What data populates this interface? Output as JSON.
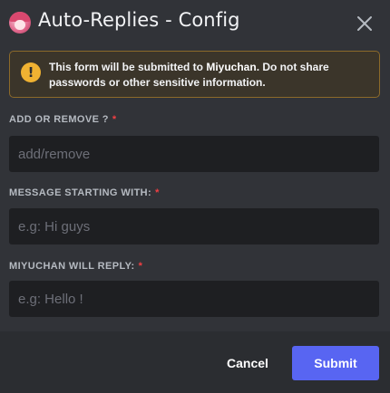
{
  "header": {
    "title": "Auto-Replies - Config",
    "close_icon": "close-icon"
  },
  "notice": {
    "icon": "warning-icon",
    "icon_glyph": "!",
    "text_before": "This form will be submitted to ",
    "bot_name": "Miyuchan",
    "text_after": ". Do not share passwords or other sensitive information."
  },
  "fields": [
    {
      "label": "ADD OR REMOVE ?",
      "required_mark": "*",
      "placeholder": "add/remove",
      "value": ""
    },
    {
      "label": "MESSAGE STARTING WITH:",
      "required_mark": "*",
      "placeholder": "e.g: Hi guys",
      "value": ""
    },
    {
      "label": "MIYUCHAN WILL REPLY:",
      "required_mark": "*",
      "placeholder": "e.g: Hello !",
      "value": ""
    }
  ],
  "footer": {
    "cancel_label": "Cancel",
    "submit_label": "Submit"
  },
  "colors": {
    "background": "#313338",
    "footer": "#2b2d31",
    "input": "#1e1f22",
    "accent": "#5865f2",
    "warning": "#f0b232",
    "required": "#f23f43"
  }
}
